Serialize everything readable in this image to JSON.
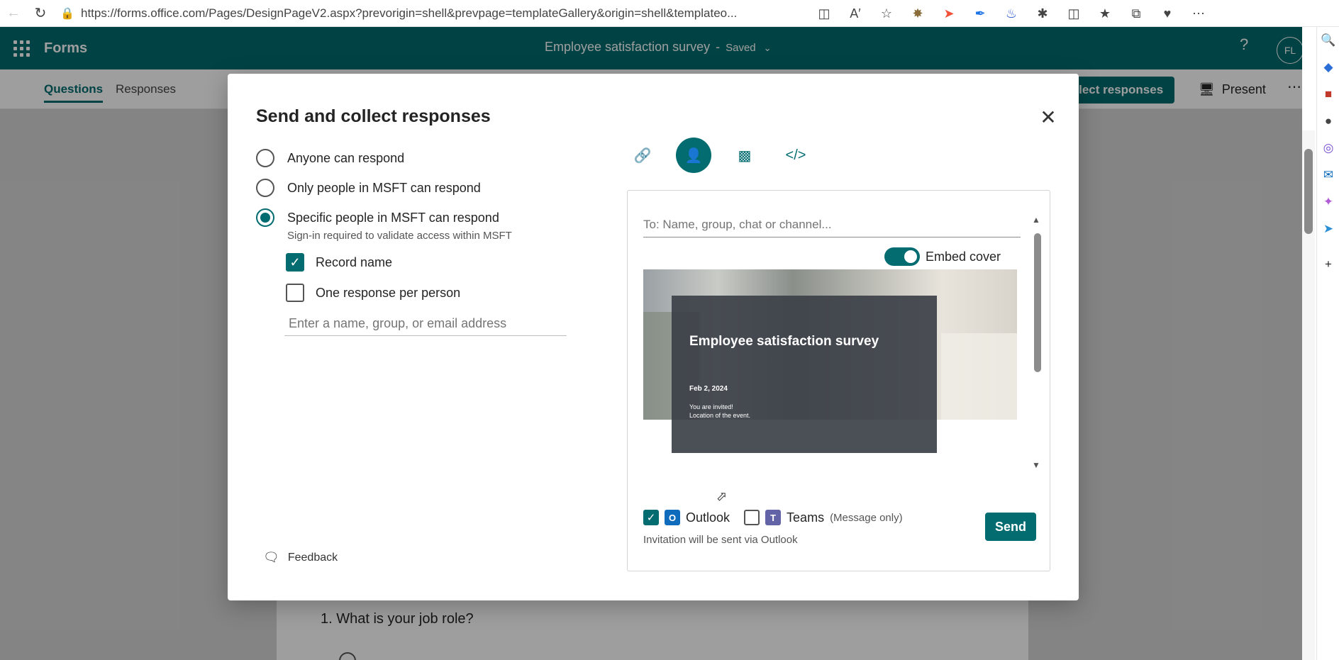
{
  "browser": {
    "url": "https://forms.office.com/Pages/DesignPageV2.aspx?prevorigin=shell&prevpage=templateGallery&origin=shell&templateo..."
  },
  "app": {
    "name": "Forms",
    "doc_title": "Employee satisfaction survey",
    "separator": "-",
    "save_status": "Saved",
    "avatar_initials": "FL",
    "help": "?"
  },
  "tabs": {
    "questions": "Questions",
    "responses": "Responses"
  },
  "actions": {
    "collect": "ollect responses",
    "present": "Present",
    "more": "⋯"
  },
  "background": {
    "question_title": "1. What is your job role?"
  },
  "dialog": {
    "title": "Send and collect responses",
    "close": "✕",
    "options": [
      {
        "label": "Anyone can respond",
        "selected": false
      },
      {
        "label": "Only people in MSFT can respond",
        "selected": false
      },
      {
        "label": "Specific people in MSFT can respond",
        "selected": true
      }
    ],
    "hint": "Sign-in required to validate access within MSFT",
    "record_name": "Record name",
    "one_response": "One response per person",
    "people_placeholder": "Enter a name, group, or email address",
    "feedback": "Feedback"
  },
  "panel": {
    "to_placeholder": "To: Name, group, chat or channel...",
    "embed_cover": "Embed cover",
    "cover": {
      "title": "Employee satisfaction survey",
      "date": "Feb 2, 2024",
      "line1": "You are invited!",
      "line2": "Location of the event."
    },
    "outlook": "Outlook",
    "teams": "Teams",
    "message_only": "(Message only)",
    "via": "Invitation will be sent via Outlook",
    "send": "Send"
  },
  "colors": {
    "brand": "#036c70"
  }
}
